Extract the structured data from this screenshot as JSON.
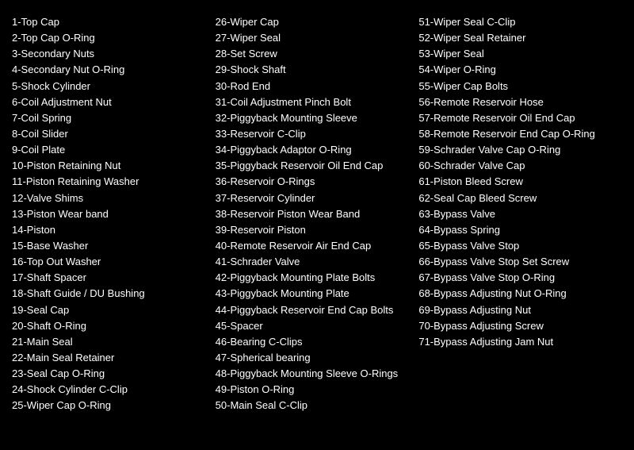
{
  "col1": {
    "items": [
      "1-Top Cap",
      "2-Top Cap O-Ring",
      "3-Secondary Nuts",
      "4-Secondary Nut O-Ring",
      "5-Shock Cylinder",
      "6-Coil Adjustment Nut",
      "7-Coil Spring",
      "8-Coil Slider",
      "9-Coil Plate",
      "10-Piston Retaining Nut",
      "11-Piston Retaining Washer",
      "12-Valve Shims",
      "13-Piston Wear band",
      "14-Piston",
      "15-Base Washer",
      "16-Top Out Washer",
      "17-Shaft Spacer",
      "18-Shaft Guide / DU Bushing",
      "19-Seal Cap",
      "20-Shaft O-Ring",
      "21-Main Seal",
      "22-Main Seal Retainer",
      "23-Seal Cap O-Ring",
      "24-Shock Cylinder C-Clip",
      "25-Wiper Cap O-Ring"
    ]
  },
  "col2": {
    "items": [
      "26-Wiper Cap",
      "27-Wiper Seal",
      "28-Set Screw",
      "29-Shock Shaft",
      "30-Rod End",
      "31-Coil Adjustment Pinch Bolt",
      "32-Piggyback Mounting Sleeve",
      "33-Reservoir C-Clip",
      "34-Piggyback Adaptor O-Ring",
      "35-Piggyback Reservoir Oil End Cap",
      "36-Reservoir O-Rings",
      "37-Reservoir Cylinder",
      "38-Reservoir Piston Wear Band",
      "39-Reservoir Piston",
      "40-Remote Reservoir Air End Cap",
      "41-Schrader Valve",
      "42-Piggyback Mounting Plate Bolts",
      "43-Piggyback Mounting Plate",
      "44-Piggyback Reservoir End Cap Bolts",
      "45-Spacer",
      "46-Bearing C-Clips",
      "47-Spherical bearing",
      "48-Piggyback Mounting Sleeve O-Rings",
      "49-Piston O-Ring",
      "50-Main Seal C-Clip"
    ]
  },
  "col3": {
    "items": [
      "51-Wiper Seal C-Clip",
      "52-Wiper Seal Retainer",
      "53-Wiper Seal",
      "54-Wiper O-Ring",
      "55-Wiper Cap Bolts",
      "56-Remote Reservoir Hose",
      "57-Remote Reservoir Oil End Cap",
      "58-Remote Reservoir End Cap O-Ring",
      "59-Schrader Valve Cap O-Ring",
      "60-Schrader Valve Cap",
      "61-Piston Bleed Screw",
      "62-Seal Cap Bleed Screw",
      "63-Bypass Valve",
      "64-Bypass Spring",
      "65-Bypass Valve Stop",
      "66-Bypass Valve Stop Set Screw",
      "67-Bypass Valve Stop O-Ring",
      "68-Bypass Adjusting Nut O-Ring",
      "69-Bypass Adjusting Nut",
      "70-Bypass Adjusting Screw",
      "71-Bypass Adjusting Jam Nut"
    ]
  }
}
